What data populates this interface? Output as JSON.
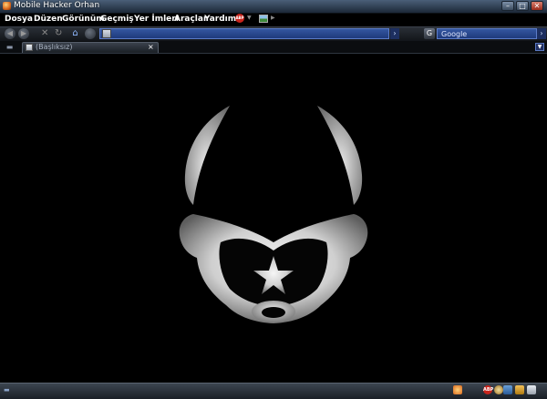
{
  "window": {
    "title": "Mobile Hacker Orhan",
    "minimize_glyph": "–",
    "maximize_glyph": "□",
    "close_glyph": "✕"
  },
  "menu": {
    "items": [
      "Dosya",
      "Düzen",
      "Görünüm",
      "Geçmiş",
      "Yer İmleri",
      "Araçlar",
      "Yardım"
    ]
  },
  "toolbar": {
    "back_glyph": "◀",
    "forward_glyph": "▶",
    "stop_glyph": "✕",
    "reload_glyph": "↻",
    "home_glyph": "⌂",
    "go_glyph": "›",
    "adblock_label": "ABP"
  },
  "search": {
    "engine": "Google",
    "placeholder": "Google",
    "go_glyph": "›"
  },
  "tabs": [
    {
      "title": "(Başlıksız)",
      "close_glyph": "×"
    }
  ],
  "status": {
    "tray_labels": [
      "ABP"
    ]
  },
  "colors": {
    "accent": "#3456a0",
    "titlebar_top": "#4a5f78",
    "background": "#000000",
    "face_light": "#f2f2f2",
    "face_dark": "#6a6a6a"
  },
  "icons": [
    "firefox-icon",
    "adblock-icon",
    "image-icon",
    "home-icon",
    "search-engine-icon",
    "tab-list-icon",
    "tray-icons"
  ]
}
